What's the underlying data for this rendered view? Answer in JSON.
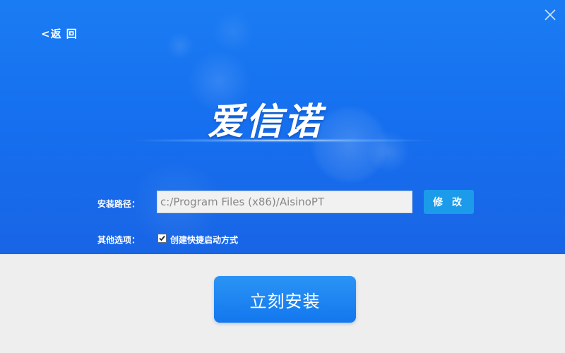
{
  "header": {
    "back_label": "<返 回",
    "close_icon": "close-icon",
    "logo_text": "爱信诺"
  },
  "form": {
    "path_label": "安装路径：",
    "path_value": "c:/Program Files (x86)/AisinoPT",
    "modify_label": "修 改",
    "options_label": "其他选项：",
    "shortcut_checked": true,
    "shortcut_label": "创建快捷启动方式"
  },
  "footer": {
    "install_label": "立刻安装"
  },
  "colors": {
    "hero_blue": "#1670ef",
    "modify_blue": "#1c9bea",
    "install_blue": "#1377ee",
    "footer_gray": "#eeeeee"
  }
}
